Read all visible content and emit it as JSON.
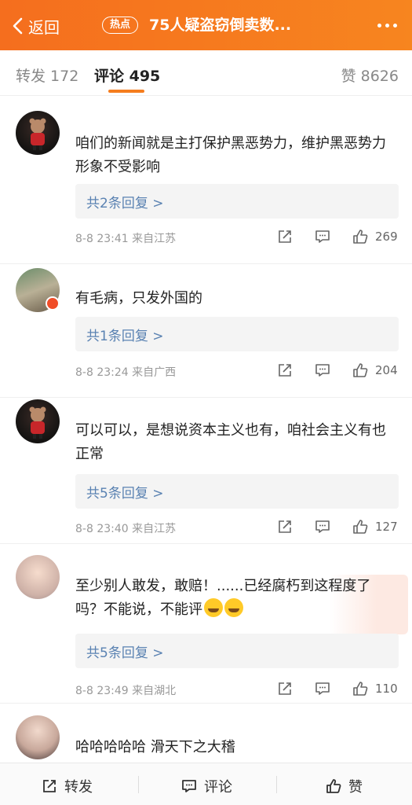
{
  "header": {
    "back_label": "返回",
    "hot_badge": "热点",
    "title": "75人疑盗窃倒卖数..."
  },
  "tabs": {
    "forward": "转发 172",
    "comments": "评论 495",
    "likes": "赞 8626"
  },
  "comments": [
    {
      "text": "咱们的新闻就是主打保护黑恶势力，维护黑恶势力形象不受影响",
      "replies": "共2条回复 >",
      "time": "8-8 23:41",
      "location": "来自江苏",
      "likes": "269"
    },
    {
      "text": "有毛病，只发外国的",
      "replies": "共1条回复 >",
      "time": "8-8 23:24",
      "location": "来自广西",
      "likes": "204"
    },
    {
      "text": "可以可以，是想说资本主义也有，咱社会主义有也正常",
      "replies": "共5条回复 >",
      "time": "8-8 23:40",
      "location": "来自江苏",
      "likes": "127"
    },
    {
      "text": "至少别人敢发，敢赔！......已经腐朽到这程度了吗？不能说，不能评",
      "replies": "共5条回复 >",
      "time": "8-8 23:49",
      "location": "来自湖北",
      "likes": "110"
    },
    {
      "text": "哈哈哈哈哈  滑天下之大稽"
    }
  ],
  "bottom_bar": {
    "forward": "转发",
    "comment": "评论",
    "like": "赞"
  },
  "colors": {
    "header_gradient_start": "#f56e1e",
    "header_gradient_end": "#f7851f",
    "tab_underline": "#f57d1e",
    "reply_link": "#5a82b2"
  }
}
